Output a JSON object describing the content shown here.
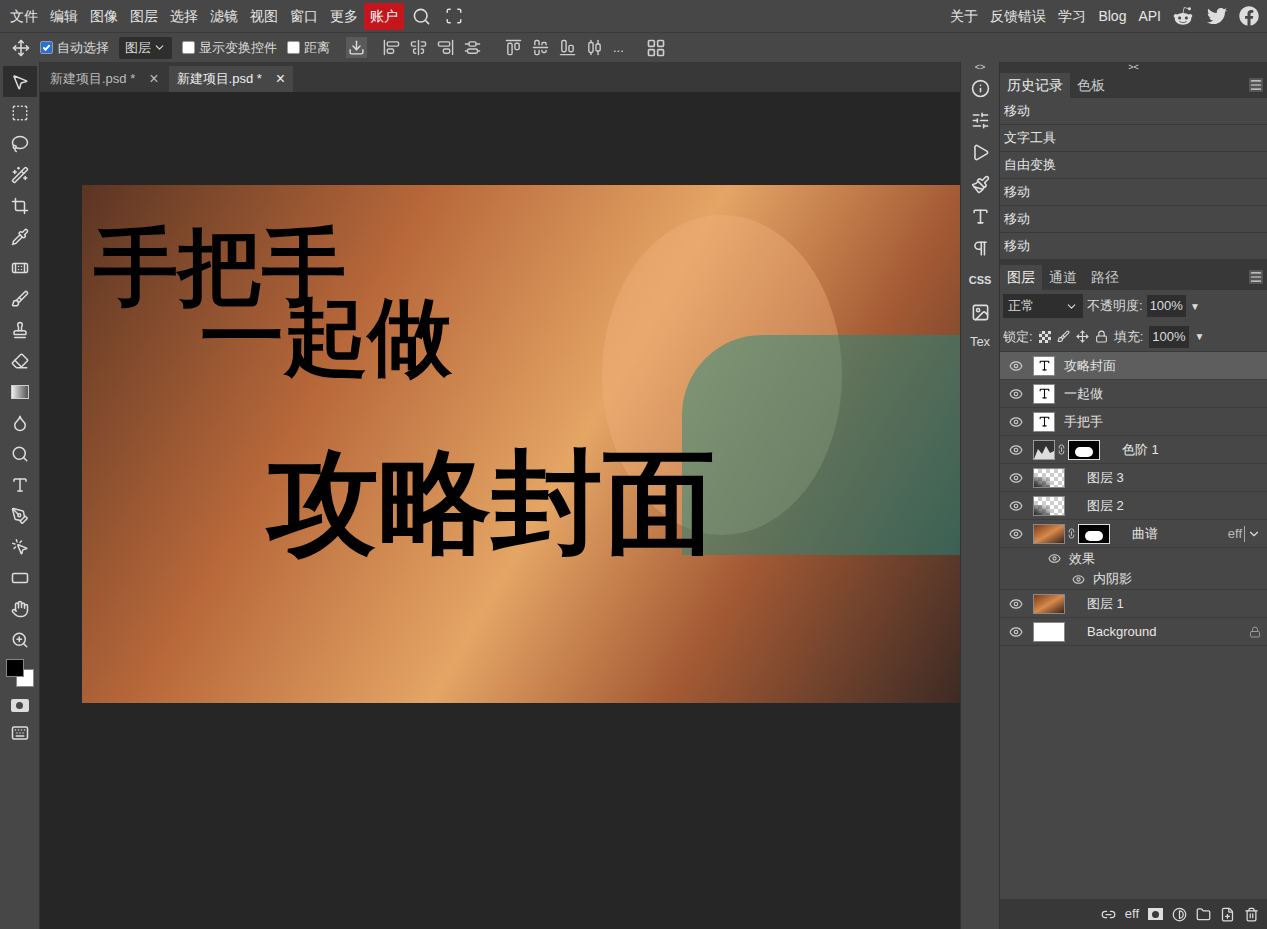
{
  "menu": [
    {
      "label": "文件",
      "highlighted": false
    },
    {
      "label": "编辑",
      "highlighted": false
    },
    {
      "label": "图像",
      "highlighted": false
    },
    {
      "label": "图层",
      "highlighted": false
    },
    {
      "label": "选择",
      "highlighted": false
    },
    {
      "label": "滤镜",
      "highlighted": false
    },
    {
      "label": "视图",
      "highlighted": false
    },
    {
      "label": "窗口",
      "highlighted": false
    },
    {
      "label": "更多",
      "highlighted": false
    },
    {
      "label": "账户",
      "highlighted": true
    }
  ],
  "links": [
    "关于",
    "反馈错误",
    "学习",
    "Blog",
    "API"
  ],
  "options_bar": {
    "auto_select": {
      "label": "自动选择",
      "checked": true
    },
    "target": "图层",
    "show_transform": {
      "label": "显示变换控件",
      "checked": false
    },
    "distance": {
      "label": "距离",
      "checked": false
    },
    "more": "..."
  },
  "toolbar": {
    "active_tool": 0
  },
  "colors": {
    "foreground": "#000000",
    "background": "#ffffff"
  },
  "doc_tabs": [
    {
      "label": "新建项目.psd *",
      "close": "×",
      "selected": false
    },
    {
      "label": "新建项目.psd *",
      "close": "×",
      "selected": true
    }
  ],
  "canvas": {
    "texts": [
      "手把手",
      "一起做",
      "攻略封面"
    ]
  },
  "side_marks": [
    "<>",
    "><"
  ],
  "side_icons": [
    "CSS",
    "Tex"
  ],
  "history_panel": {
    "tabs": [
      {
        "label": "历史记录",
        "selected": true
      },
      {
        "label": "色板",
        "selected": false
      }
    ],
    "entries": [
      "移动",
      "文字工具",
      "自由变换",
      "移动",
      "移动",
      "移动"
    ]
  },
  "layers_panel": {
    "tabs": [
      {
        "label": "图层",
        "selected": true
      },
      {
        "label": "通道",
        "selected": false
      },
      {
        "label": "路径",
        "selected": false
      }
    ],
    "blend_mode": "正常",
    "opacity_label": "不透明度:",
    "opacity": "100%",
    "lock_label": "锁定:",
    "fill_label": "填充:",
    "fill": "100%",
    "layers": [
      {
        "name": "攻略封面",
        "kind": "text",
        "selected": true,
        "visible": true,
        "locked": false,
        "mask": false
      },
      {
        "name": "一起做",
        "kind": "text",
        "selected": false,
        "visible": true,
        "locked": false,
        "mask": false
      },
      {
        "name": "手把手",
        "kind": "text",
        "selected": false,
        "visible": true,
        "locked": false,
        "mask": false
      },
      {
        "name": "色阶 1",
        "kind": "adjustment",
        "selected": false,
        "visible": true,
        "locked": false,
        "mask": true
      },
      {
        "name": "图层 3",
        "kind": "transparent",
        "selected": false,
        "visible": true,
        "locked": false,
        "mask": false
      },
      {
        "name": "图层 2",
        "kind": "transparent",
        "selected": false,
        "visible": true,
        "locked": false,
        "mask": false
      },
      {
        "name": "曲谱",
        "kind": "image",
        "selected": false,
        "visible": true,
        "locked": false,
        "mask": true,
        "effects": {
          "badge": "eff",
          "expanded": true,
          "label": "效果",
          "items": [
            {
              "name": "内阴影",
              "visible": true
            }
          ]
        }
      },
      {
        "name": "图层 1",
        "kind": "image",
        "selected": false,
        "visible": true,
        "locked": false,
        "mask": false
      },
      {
        "name": "Background",
        "kind": "background",
        "selected": false,
        "visible": true,
        "locked": true,
        "mask": false
      }
    ],
    "footer_badge": "eff"
  }
}
